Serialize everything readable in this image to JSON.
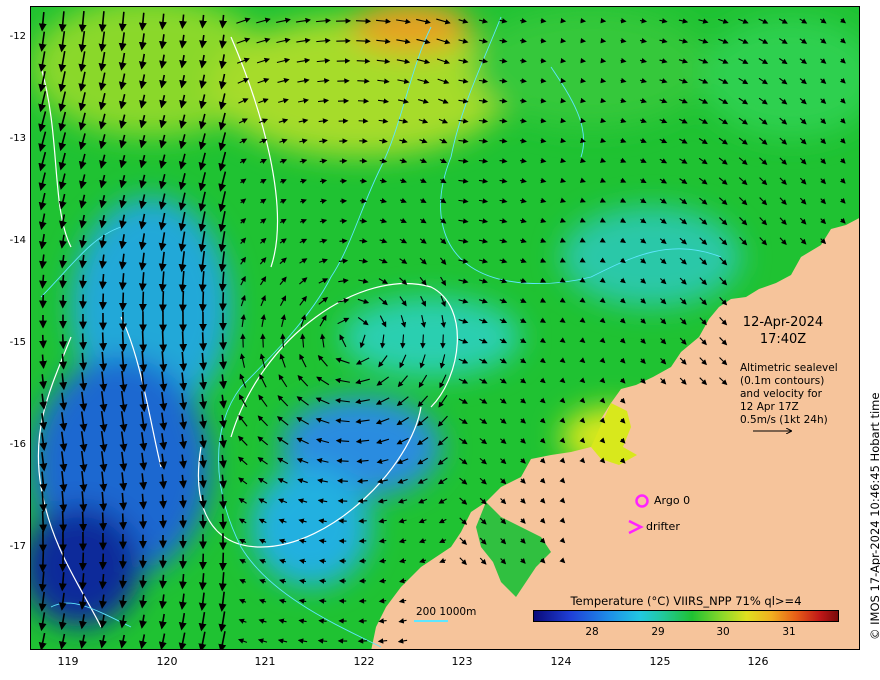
{
  "map": {
    "lat_ticks": [
      "-12",
      "-13",
      "-14",
      "-15",
      "-16",
      "-17"
    ],
    "lon_ticks": [
      "119",
      "120",
      "121",
      "122",
      "123",
      "124",
      "125",
      "126"
    ],
    "date": "12-Apr-2024",
    "time": "17:40Z",
    "description_lines": [
      "Altimetric sealevel",
      "(0.1m contours)",
      "and velocity for",
      "12 Apr 17Z",
      "0.5m/s (1kt 24h)"
    ],
    "copyright": "© IMOS 17-Apr-2024 10:46:45 Hobart time",
    "depth_contours_label": "200  1000m",
    "argo_label": "Argo 0",
    "drifter_label": "drifter"
  },
  "colorbar": {
    "title": "Temperature (°C) VIIRS_NPP 71% ql>=4",
    "ticks": [
      "28",
      "29",
      "30",
      "31"
    ]
  },
  "colors": {
    "land": "#f6c49b",
    "ocean_green": "#1fc232",
    "ocean_cyan": "#22c8e0",
    "ocean_blue": "#1656c8",
    "warm_yellow": "#d8e81c",
    "contour_white": "#ffffff",
    "bathymetry_cyan": "#5ee6ff",
    "argo_magenta": "#ff22ff"
  }
}
